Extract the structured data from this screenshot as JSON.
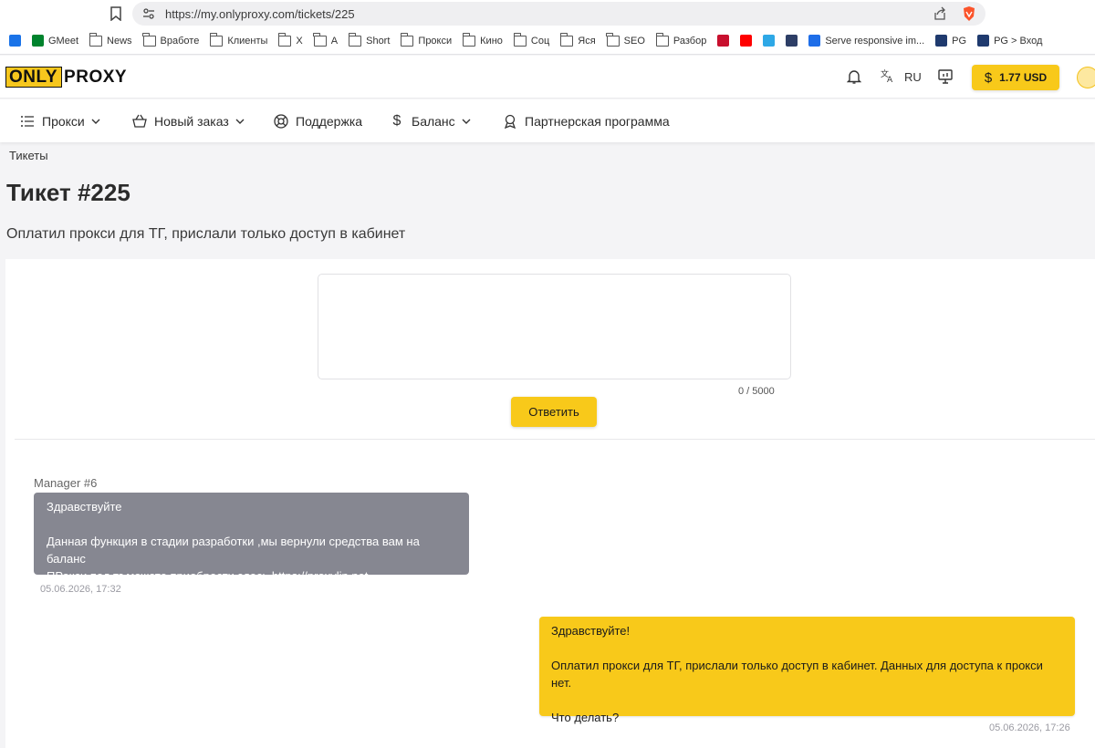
{
  "browser": {
    "url": "https://my.onlyproxy.com/tickets/225",
    "bookmarks": [
      {
        "label": "",
        "icon": "app-icon",
        "color": "#1a73e8"
      },
      {
        "label": "GMeet",
        "icon": "gmeet-icon",
        "color": "#00832d"
      },
      {
        "label": "News",
        "icon": "folder-icon"
      },
      {
        "label": "Вработе",
        "icon": "folder-icon"
      },
      {
        "label": "Клиенты",
        "icon": "folder-icon"
      },
      {
        "label": "X",
        "icon": "folder-icon"
      },
      {
        "label": "A",
        "icon": "folder-icon"
      },
      {
        "label": "Short",
        "icon": "folder-icon"
      },
      {
        "label": "Прокси",
        "icon": "folder-icon"
      },
      {
        "label": "Кино",
        "icon": "folder-icon"
      },
      {
        "label": "Соц",
        "icon": "folder-icon"
      },
      {
        "label": "Яся",
        "icon": "folder-icon"
      },
      {
        "label": "SEO",
        "icon": "folder-icon"
      },
      {
        "label": "Разбор",
        "icon": "folder-icon"
      },
      {
        "label": "",
        "icon": "r-icon",
        "color": "#c8102e"
      },
      {
        "label": "",
        "icon": "youtube-icon",
        "color": "#ff0000"
      },
      {
        "label": "",
        "icon": "ip-icon",
        "color": "#2ea8e6"
      },
      {
        "label": "",
        "icon": "eye-icon",
        "color": "#2d3e66"
      },
      {
        "label": "Serve responsive im...",
        "icon": "arrow-icon",
        "color": "#1e6ee8"
      },
      {
        "label": "PG",
        "icon": "pg-icon",
        "color": "#1f3a6e"
      },
      {
        "label": "PG > Вход",
        "icon": "pg-icon",
        "color": "#1f3a6e"
      }
    ]
  },
  "header": {
    "logo_left": "ONLY",
    "logo_right": "PROXY",
    "language": "RU",
    "balance": "1.77 USD",
    "balance_symbol": "$"
  },
  "nav": [
    {
      "label": "Прокси",
      "icon": "list-icon",
      "dropdown": true
    },
    {
      "label": "Новый заказ",
      "icon": "basket-icon",
      "dropdown": true
    },
    {
      "label": "Поддержка",
      "icon": "lifebuoy-icon",
      "dropdown": false
    },
    {
      "label": "Баланс",
      "icon": "dollar-icon",
      "dropdown": true
    },
    {
      "label": "Партнерская программа",
      "icon": "award-icon",
      "dropdown": false
    }
  ],
  "page": {
    "breadcrumb": "Тикеты",
    "title": "Тикет #225",
    "subtitle": "Оплатил прокси для ТГ, прислали только доступ в кабинет"
  },
  "reply": {
    "counter": "0 / 5000",
    "button": "Ответить",
    "value": ""
  },
  "messages": [
    {
      "author": "Manager #6",
      "lines": [
        "Здравствуйте",
        "",
        "Данная функция в стадии разработки ,мы вернули средства вам на баланс",
        "ПРокси под тг можете приобрести здесь https://proxylin.net"
      ],
      "time": "05.06.2026, 17:32"
    },
    {
      "author": "",
      "lines": [
        "Здравствуйте!",
        "",
        "Оплатил прокси для ТГ, прислали только доступ в кабинет. Данных для доступа к прокси нет.",
        "",
        "Что делать?"
      ],
      "time": "05.06.2026, 17:26"
    }
  ],
  "colors": {
    "accent": "#f8c91a",
    "manager_bubble": "#868791",
    "background": "#f4f4f6"
  }
}
